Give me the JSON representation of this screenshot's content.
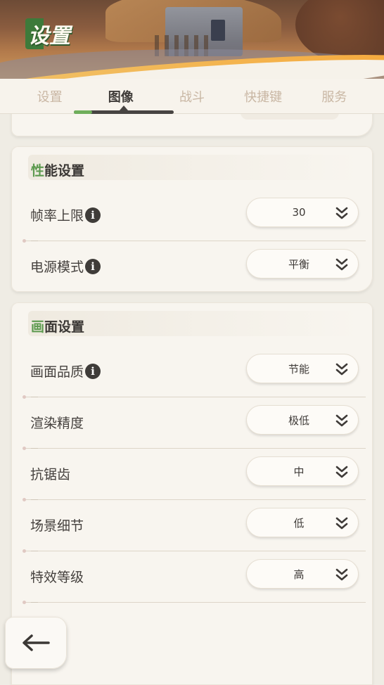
{
  "header": {
    "title": "设置"
  },
  "tabs": [
    {
      "label": "设置",
      "active": false
    },
    {
      "label": "图像",
      "active": true
    },
    {
      "label": "战斗",
      "active": false
    },
    {
      "label": "快捷键",
      "active": false
    },
    {
      "label": "服务",
      "active": false
    }
  ],
  "sections": {
    "performance": {
      "title_accent": "性",
      "title_rest": "能设置",
      "rows": [
        {
          "label": "帧率上限",
          "has_info": true,
          "value": "30"
        },
        {
          "label": "电源模式",
          "has_info": true,
          "value": "平衡"
        }
      ]
    },
    "display": {
      "title_accent": "画",
      "title_rest": "面设置",
      "rows": [
        {
          "label": "画面品质",
          "has_info": true,
          "value": "节能"
        },
        {
          "label": "渲染精度",
          "has_info": false,
          "value": "极低"
        },
        {
          "label": "抗锯齿",
          "has_info": false,
          "value": "中"
        },
        {
          "label": "场景细节",
          "has_info": false,
          "value": "低"
        },
        {
          "label": "特效等级",
          "has_info": false,
          "value": "高"
        }
      ]
    }
  },
  "info_glyph": "i",
  "icons": {
    "info": "info-icon",
    "dropdown": "double-chevron-down-icon",
    "back": "back-arrow-icon"
  },
  "colors": {
    "accent_green": "#5d9a4f",
    "active_tab_text": "#3f3c39",
    "inactive_tab_text": "#c9b7a4",
    "background": "#efece4"
  }
}
